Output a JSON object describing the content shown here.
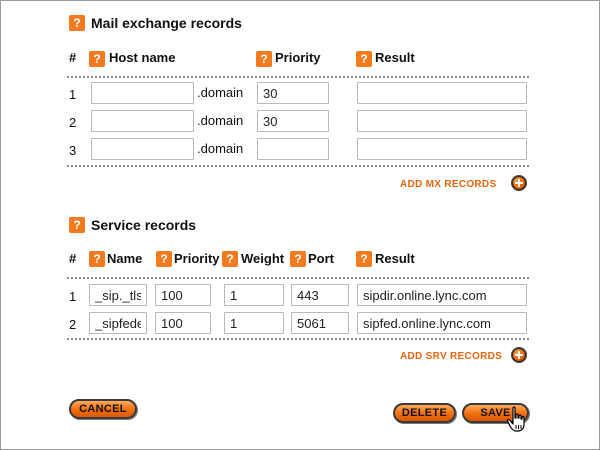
{
  "mx": {
    "title": "Mail exchange records",
    "headers": {
      "num": "#",
      "host": "Host name",
      "priority": "Priority",
      "result": "Result"
    },
    "rows": [
      {
        "num": "1",
        "host": "",
        "suffix": ".domain",
        "priority": "30",
        "result": ""
      },
      {
        "num": "2",
        "host": "",
        "suffix": ".domain",
        "priority": "30",
        "result": ""
      },
      {
        "num": "3",
        "host": "",
        "suffix": ".domain",
        "priority": "",
        "result": ""
      }
    ],
    "add_label": "ADD MX RECORDS"
  },
  "srv": {
    "title": "Service records",
    "headers": {
      "num": "#",
      "name": "Name",
      "priority": "Priority",
      "weight": "Weight",
      "port": "Port",
      "result": "Result"
    },
    "rows": [
      {
        "num": "1",
        "name": "_sip._tls",
        "priority": "100",
        "weight": "1",
        "port": "443",
        "result": "sipdir.online.lync.com"
      },
      {
        "num": "2",
        "name": "_sipfede",
        "priority": "100",
        "weight": "1",
        "port": "5061",
        "result": "sipfed.online.lync.com"
      }
    ],
    "add_label": "ADD SRV RECORDS"
  },
  "actions": {
    "cancel": "CANCEL",
    "delete": "DELETE",
    "save": "SAVE"
  },
  "icons": {
    "help": "?",
    "help_icon_name": "help-icon",
    "add_icon_name": "plus-circle-icon"
  },
  "colors": {
    "accent": "#f37a1f",
    "link": "#e8650d"
  }
}
